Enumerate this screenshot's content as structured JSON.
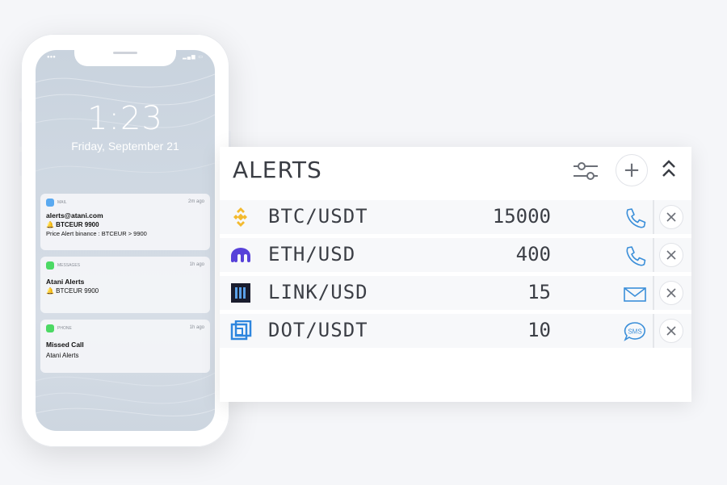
{
  "phone": {
    "time": "1:23",
    "date": "Friday, September 21",
    "notifications": [
      {
        "app": "MAIL",
        "ago": "2m ago",
        "line1": "alerts@atani.com",
        "line2": "🔔 BTCEUR 9900",
        "line3": "Price Alert binance : BTCEUR > 9900",
        "icon": "mail-app-icon",
        "color": "#5aa9f0"
      },
      {
        "app": "MESSAGES",
        "ago": "1h ago",
        "line1": "Atani Alerts",
        "line2": "🔔 BTCEUR 9900",
        "icon": "messages-app-icon",
        "color": "#4cd964"
      },
      {
        "app": "PHONE",
        "ago": "1h ago",
        "line1": "Missed Call",
        "line2": "Atani Alerts",
        "icon": "phone-app-icon",
        "color": "#4cd964"
      }
    ]
  },
  "panel": {
    "title": "ALERTS",
    "filter_icon": "sliders-icon",
    "add_icon": "plus-icon",
    "add_label": "+",
    "collapse_icon": "chevron-up-icon",
    "rows": [
      {
        "pair": "BTC/USDT",
        "value": "15000",
        "exchange_icon": "binance-logo-icon",
        "channel": "phone-icon",
        "accent": "#f3ba2f"
      },
      {
        "pair": "ETH/USD",
        "value": "400",
        "exchange_icon": "kraken-logo-icon",
        "channel": "phone-icon",
        "accent": "#5741d9"
      },
      {
        "pair": "LINK/USD",
        "value": "15",
        "exchange_icon": "exchange-logo-icon",
        "channel": "mail-icon",
        "accent": "#1a1d2e"
      },
      {
        "pair": "DOT/USDT",
        "value": "10",
        "exchange_icon": "exchange-logo-icon",
        "channel": "sms-icon",
        "accent": "#2e86de"
      }
    ]
  },
  "colors": {
    "channel_blue": "#3b8fd9",
    "text_dark": "#3c3f46"
  }
}
